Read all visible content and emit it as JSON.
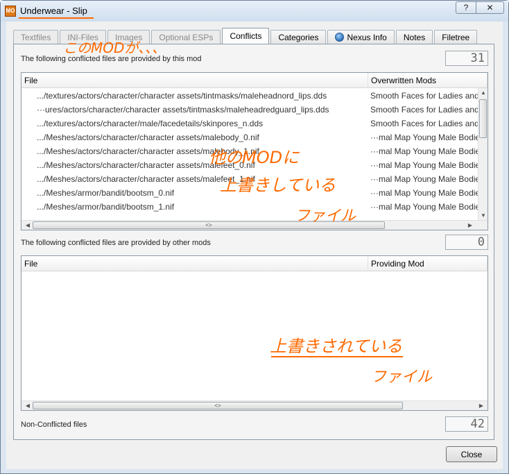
{
  "window": {
    "app_icon_text": "MO",
    "title": "Underwear - Slip",
    "help_label": "?",
    "close_glyph": "✕"
  },
  "tabs": [
    {
      "label": "Textfiles",
      "state": "disabled"
    },
    {
      "label": "INI-Files",
      "state": "disabled"
    },
    {
      "label": "Images",
      "state": "disabled"
    },
    {
      "label": "Optional ESPs",
      "state": "disabled"
    },
    {
      "label": "Conflicts",
      "state": "active"
    },
    {
      "label": "Categories",
      "state": "enabled"
    },
    {
      "label": "Nexus Info",
      "state": "enabled",
      "icon": "globe-icon"
    },
    {
      "label": "Notes",
      "state": "enabled"
    },
    {
      "label": "Filetree",
      "state": "enabled"
    }
  ],
  "overwrites": {
    "label": "The following conflicted files are provided by this mod",
    "count": "31",
    "columns": {
      "file": "File",
      "mods": "Overwritten Mods"
    },
    "rows": [
      {
        "file": ".../textures/actors/character/character assets/tintmasks/maleheadnord_lips.dds",
        "mods": "Smooth Faces for Ladies and Gents"
      },
      {
        "file": "···ures/actors/character/character assets/tintmasks/maleheadredguard_lips.dds",
        "mods": "Smooth Faces for Ladies and Gents"
      },
      {
        "file": ".../textures/actors/character/male/facedetails/skinpores_n.dds",
        "mods": "Smooth Faces for Ladies and Gents"
      },
      {
        "file": ".../Meshes/actors/character/character assets/malebody_0.nif",
        "mods": "···mal Map Young Male Bodies"
      },
      {
        "file": ".../Meshes/actors/character/character assets/malebody_1.nif",
        "mods": "···mal Map Young Male Bodies"
      },
      {
        "file": ".../Meshes/actors/character/character assets/malefeet_0.nif",
        "mods": "···mal Map Young Male Bodies"
      },
      {
        "file": ".../Meshes/actors/character/character assets/malefeet_1.nif",
        "mods": "···mal Map Young Male Bodies"
      },
      {
        "file": ".../Meshes/armor/bandit/bootsm_0.nif",
        "mods": "···mal Map Young Male Bodies"
      },
      {
        "file": ".../Meshes/armor/bandit/bootsm_1.nif",
        "mods": "···mal Map Young Male Bodies"
      }
    ],
    "hscroll_glyph": "<>"
  },
  "overwritten": {
    "label": "The following conflicted files are provided by other mods",
    "count": "0",
    "columns": {
      "file": "File",
      "mods": "Providing Mod"
    },
    "rows": [],
    "hscroll_glyph": "<>"
  },
  "nonconflicted": {
    "label": "Non-Conflicted files",
    "count": "42"
  },
  "close_button": "Close",
  "annotations": {
    "top": "このMODが、、、",
    "middle_line1": "他のMODに",
    "middle_line2": "上書きしている",
    "middle_line3": "ファイル",
    "bottom_line1": "上書きされている",
    "bottom_line2": "ファイル",
    "color": "#ff6a00"
  }
}
